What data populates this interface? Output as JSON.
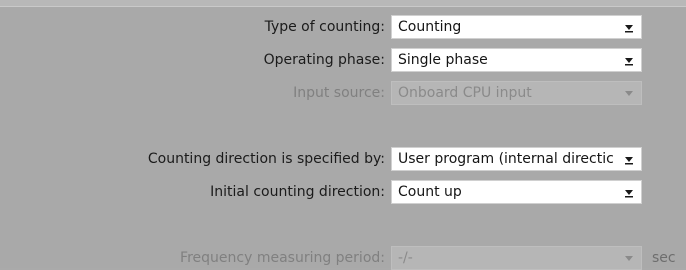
{
  "fields": {
    "type_of_counting": {
      "label": "Type of counting:",
      "value": "Counting",
      "enabled": true
    },
    "operating_phase": {
      "label": "Operating phase:",
      "value": "Single phase",
      "enabled": true
    },
    "input_source": {
      "label": "Input source:",
      "value": "Onboard CPU input",
      "enabled": false
    },
    "counting_direction_specified_by": {
      "label": "Counting direction is specified by:",
      "value": "User program (internal directic",
      "enabled": true
    },
    "initial_counting_direction": {
      "label": "Initial counting direction:",
      "value": "Count up",
      "enabled": true
    },
    "frequency_measuring_period": {
      "label": "Frequency measuring period:",
      "value": "-/-",
      "unit": "sec",
      "enabled": false
    }
  },
  "icons": {
    "dropdown": "chevron-down-icon"
  },
  "colors": {
    "background": "#a9a9a9",
    "field_enabled": "#ffffff",
    "field_disabled": "#b6b6b6",
    "text_enabled": "#1b1b1b",
    "text_disabled": "#808080"
  }
}
